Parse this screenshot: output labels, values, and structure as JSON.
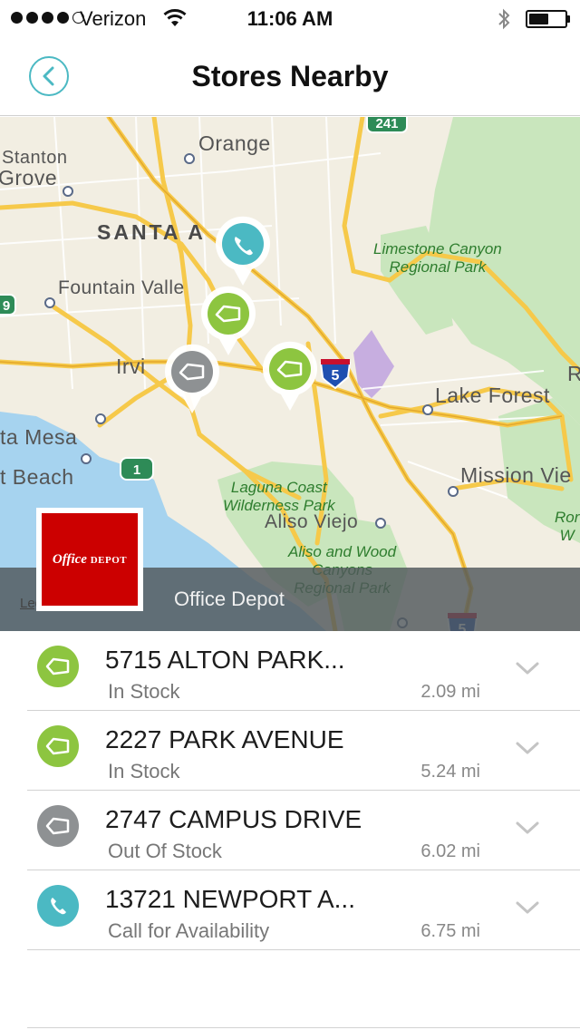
{
  "status_bar": {
    "carrier": "Verizon",
    "time": "11:06 AM",
    "signal_bars_filled": 4,
    "signal_bars_total": 5,
    "battery_level": 0.55
  },
  "nav": {
    "title": "Stores Nearby",
    "back_icon": "chevron-left-icon"
  },
  "map": {
    "labels": {
      "orange": "Orange",
      "stanton": "Stanton",
      "grove": "Grove",
      "santa_ana": "SANTA A",
      "fountain_valley": "Fountain Valle",
      "irvine": "Irvi",
      "costa_mesa": "ta Mesa",
      "newport_beach": "t Beach",
      "lake_forest": "Lake Forest",
      "mission_viejo": "Mission Vie",
      "aliso_viejo": "Aliso Viejo",
      "limestone": "Limestone Canyon\nRegional Park",
      "laguna": "Laguna Coast\nWilderness Park",
      "aliso_wood": "Aliso and Wood\nCanyons\nRegional Park",
      "ror": "Ror\nW",
      "r_edge": "R",
      "shield_241": "241",
      "shield_5": "5",
      "shield_5b": "5",
      "shield_1": "1",
      "shield_9": "9"
    },
    "legal": "Legal",
    "selected_store_name": "Office Depot",
    "logo": {
      "line1": "Office",
      "line2": "DEPOT"
    }
  },
  "colors": {
    "in_stock": "#8dc540",
    "out_of_stock": "#8e9193",
    "call": "#4bb9c3",
    "accent": "#4bb9c3"
  },
  "stores": [
    {
      "name": "5715 ALTON PARK...",
      "status": "In Stock",
      "distance": "2.09 mi",
      "icon": "tag-icon",
      "kind": "in_stock"
    },
    {
      "name": "2227 PARK AVENUE",
      "status": "In Stock",
      "distance": "5.24 mi",
      "icon": "tag-icon",
      "kind": "in_stock"
    },
    {
      "name": "2747 CAMPUS DRIVE",
      "status": "Out Of Stock",
      "distance": "6.02 mi",
      "icon": "tag-icon",
      "kind": "out_of_stock"
    },
    {
      "name": "13721 NEWPORT A...",
      "status": "Call for Availability",
      "distance": "6.75 mi",
      "icon": "phone-icon",
      "kind": "call"
    }
  ]
}
